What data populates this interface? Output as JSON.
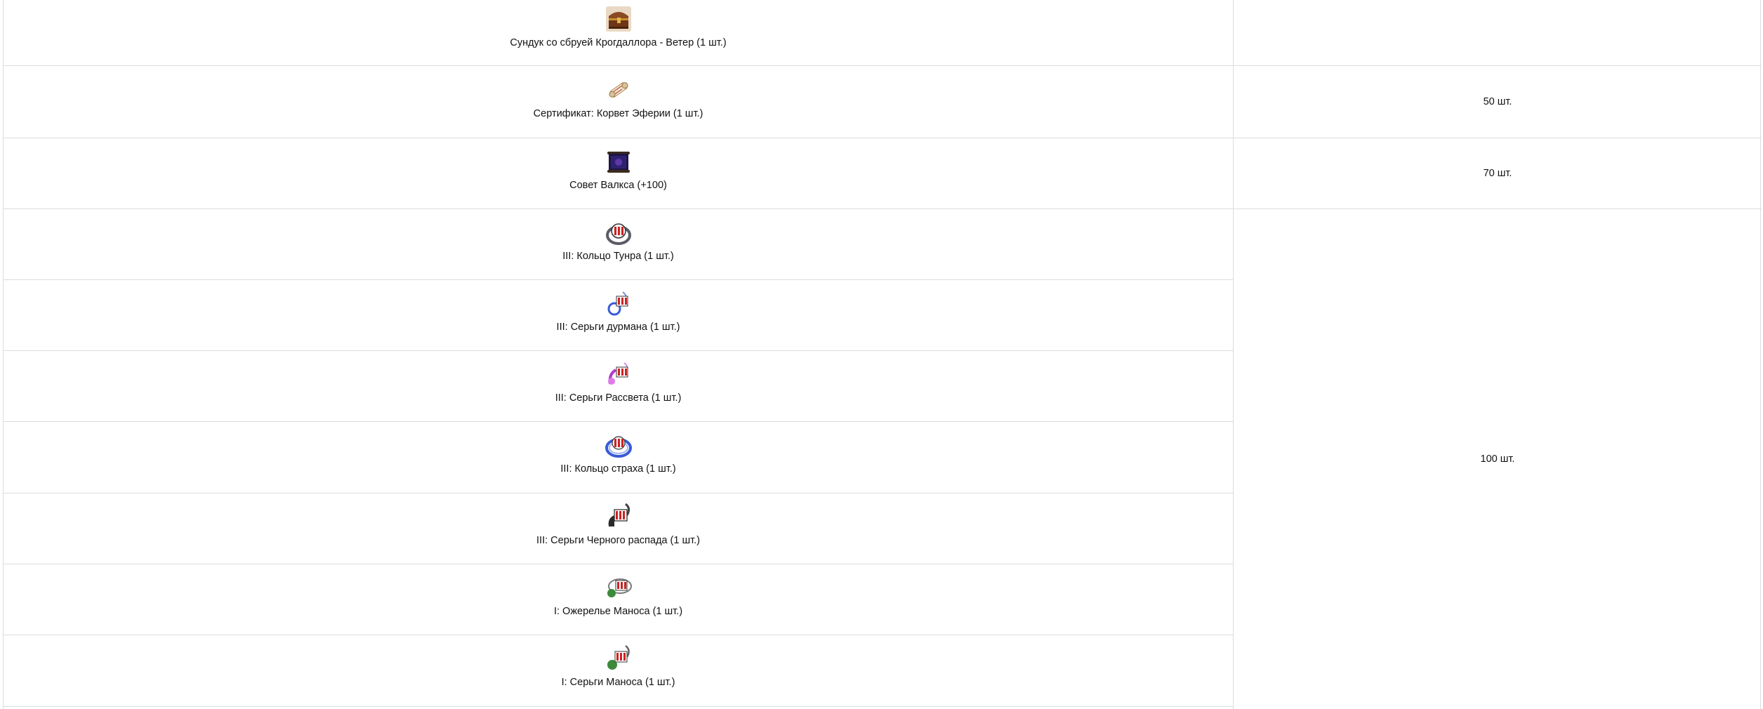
{
  "items": [
    {
      "name": "Сундук со сбруей Крогдаллора - Ветер (1 шт.)",
      "icon": "treasure-chest-icon"
    },
    {
      "name": "Сертификат: Корвет Эферии (1 шт.)",
      "icon": "certificate-scroll-icon"
    },
    {
      "name": "Совет Валкса (+100)",
      "icon": "purple-scroll-icon"
    },
    {
      "name": "III: Кольцо Тунра (1 шт.)",
      "icon": "ring-icon"
    },
    {
      "name": "III: Серьги дурмана (1 шт.)",
      "icon": "blue-earring-icon"
    },
    {
      "name": "III: Серьги Рассвета (1 шт.)",
      "icon": "purple-earring-icon"
    },
    {
      "name": "III: Кольцо страха (1 шт.)",
      "icon": "fear-ring-icon"
    },
    {
      "name": "III: Серьги Черного распада (1 шт.)",
      "icon": "dark-earring-icon"
    },
    {
      "name": "I: Ожерелье Маноса (1 шт.)",
      "icon": "necklace-icon"
    },
    {
      "name": "I: Серьги Маноса (1 шт.)",
      "icon": "green-earring-icon"
    }
  ],
  "quantities": [
    "",
    "50 шт.",
    "70 шт.",
    "100 шт."
  ]
}
